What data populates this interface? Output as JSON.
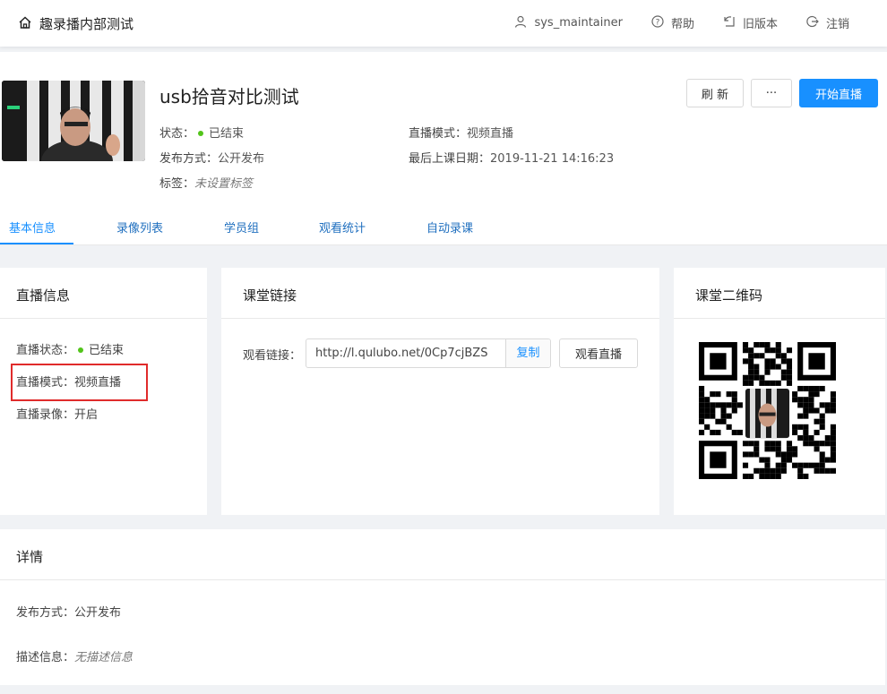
{
  "topbar": {
    "brand": "趣录播内部测试",
    "nav": [
      {
        "label": "sys_maintainer",
        "icon": "user-icon"
      },
      {
        "label": "帮助",
        "icon": "help-icon"
      },
      {
        "label": "旧版本",
        "icon": "old-version-icon"
      },
      {
        "label": "注销",
        "icon": "logout-icon"
      }
    ]
  },
  "live": {
    "title": "usb拾音对比测试",
    "status_label": "状态：",
    "status_value": "已结束",
    "mode_label": "直播模式：",
    "mode_value": "视频直播",
    "publish_label": "发布方式：",
    "publish_value": "公开发布",
    "last_date_label": "最后上课日期：",
    "last_date_value": "2019-11-21 14:16:23",
    "tags_label": "标签：",
    "tags_value": "未设置标签"
  },
  "actions": {
    "refresh": "刷 新",
    "more": "···",
    "start": "开始直播"
  },
  "tabs": [
    "基本信息",
    "录像列表",
    "学员组",
    "观看统计",
    "自动录课"
  ],
  "live_info": {
    "title": "直播信息",
    "status_label": "直播状态：",
    "status_value": "已结束",
    "mode_label": "直播模式：",
    "mode_value": "视频直播",
    "record_label": "直播录像：",
    "record_value": "开启"
  },
  "class_link": {
    "title": "课堂链接",
    "label": "观看链接：",
    "url": "http://l.qulubo.net/0Cp7cjBZS",
    "copy": "复制",
    "watch": "观看直播"
  },
  "qr": {
    "title": "课堂二维码"
  },
  "details": {
    "title": "详情",
    "publish_label": "发布方式：",
    "publish_value": "公开发布",
    "desc_label": "描述信息：",
    "desc_value": "无描述信息"
  },
  "colors": {
    "primary": "#1890ff",
    "success": "#52c41a",
    "highlight": "#e02b2b"
  }
}
